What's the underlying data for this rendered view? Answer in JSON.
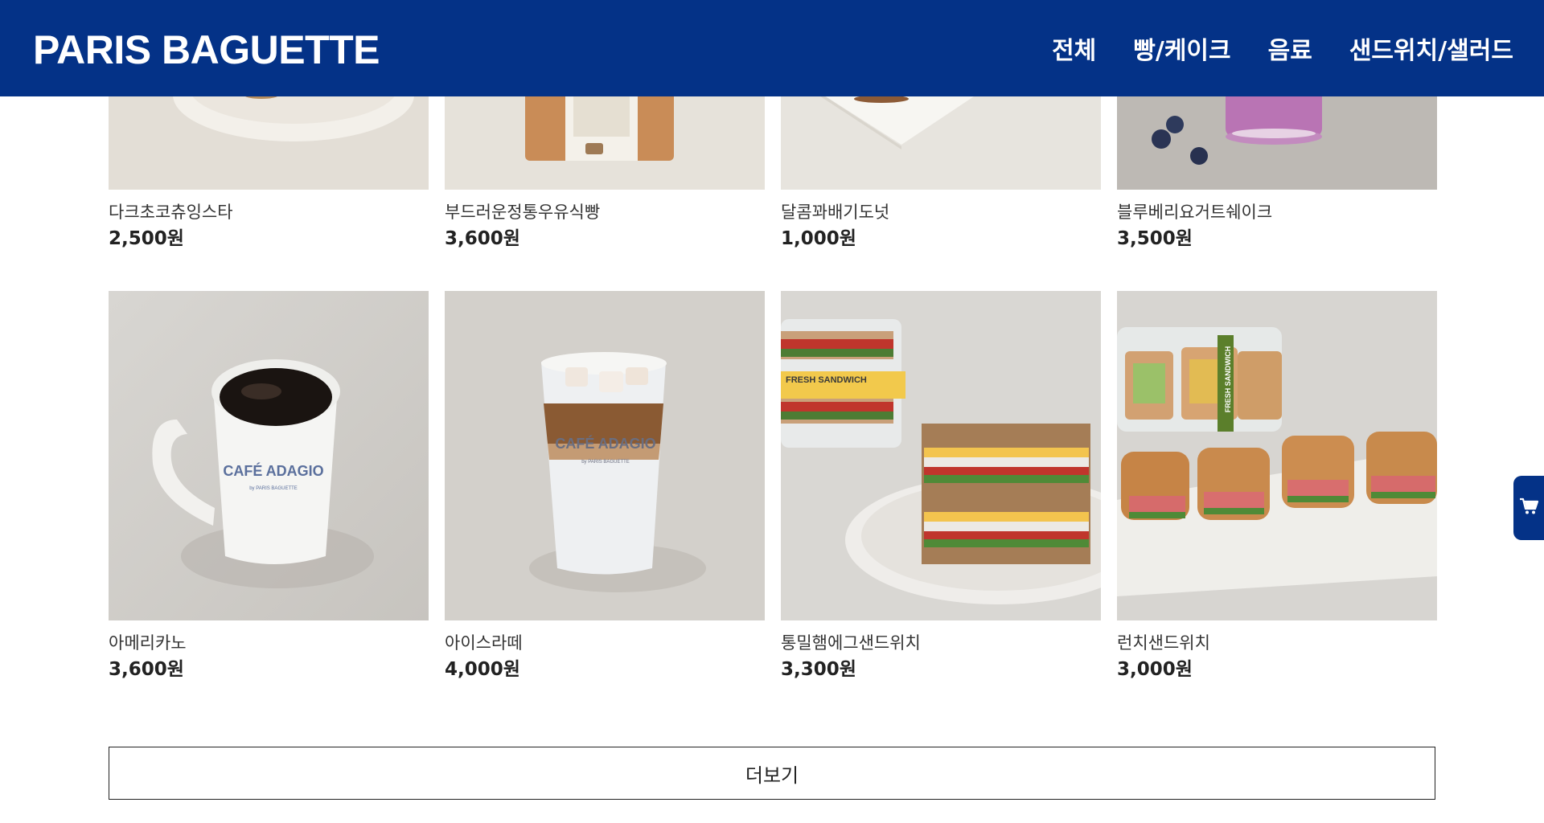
{
  "header": {
    "logo": "PARIS BAGUETTE",
    "nav": [
      "전체",
      "빵/케이크",
      "음료",
      "샌드위치/샐러드"
    ]
  },
  "products_row1": [
    {
      "name": "다크초코츄잉스타",
      "price": "2,500원",
      "image": "dark-choco-pastry-on-plate"
    },
    {
      "name": "부드러운정통우유식빵",
      "price": "3,600원",
      "image": "milk-bread-loaf-in-bag"
    },
    {
      "name": "달콤꽈배기도넛",
      "price": "1,000원",
      "image": "twisted-donut-on-plate"
    },
    {
      "name": "블루베리요거트쉐이크",
      "price": "3,500원",
      "image": "blueberry-yogurt-shake"
    }
  ],
  "products_row2": [
    {
      "name": "아메리카노",
      "price": "3,600원",
      "image": "americano-mug",
      "mug_text": "CAFÉ ADAGIO",
      "mug_sub": "by PARIS BAGUETTE"
    },
    {
      "name": "아이스라떼",
      "price": "4,000원",
      "image": "iced-latte-glass",
      "glass_text": "CAFÉ ADAGIO",
      "glass_sub": "by PARIS BAGUETTE"
    },
    {
      "name": "통밀햄에그샌드위치",
      "price": "3,300원",
      "image": "wheat-ham-egg-sandwich",
      "pack_label": "FRESH SANDWICH"
    },
    {
      "name": "런치샌드위치",
      "price": "3,000원",
      "image": "lunch-sandwich-platter",
      "pack_label": "FRESH SANDWICH"
    }
  ],
  "more_button": "더보기",
  "cart_icon": "shopping-cart-icon",
  "colors": {
    "brand_blue": "#043287",
    "background": "#ffffff"
  }
}
